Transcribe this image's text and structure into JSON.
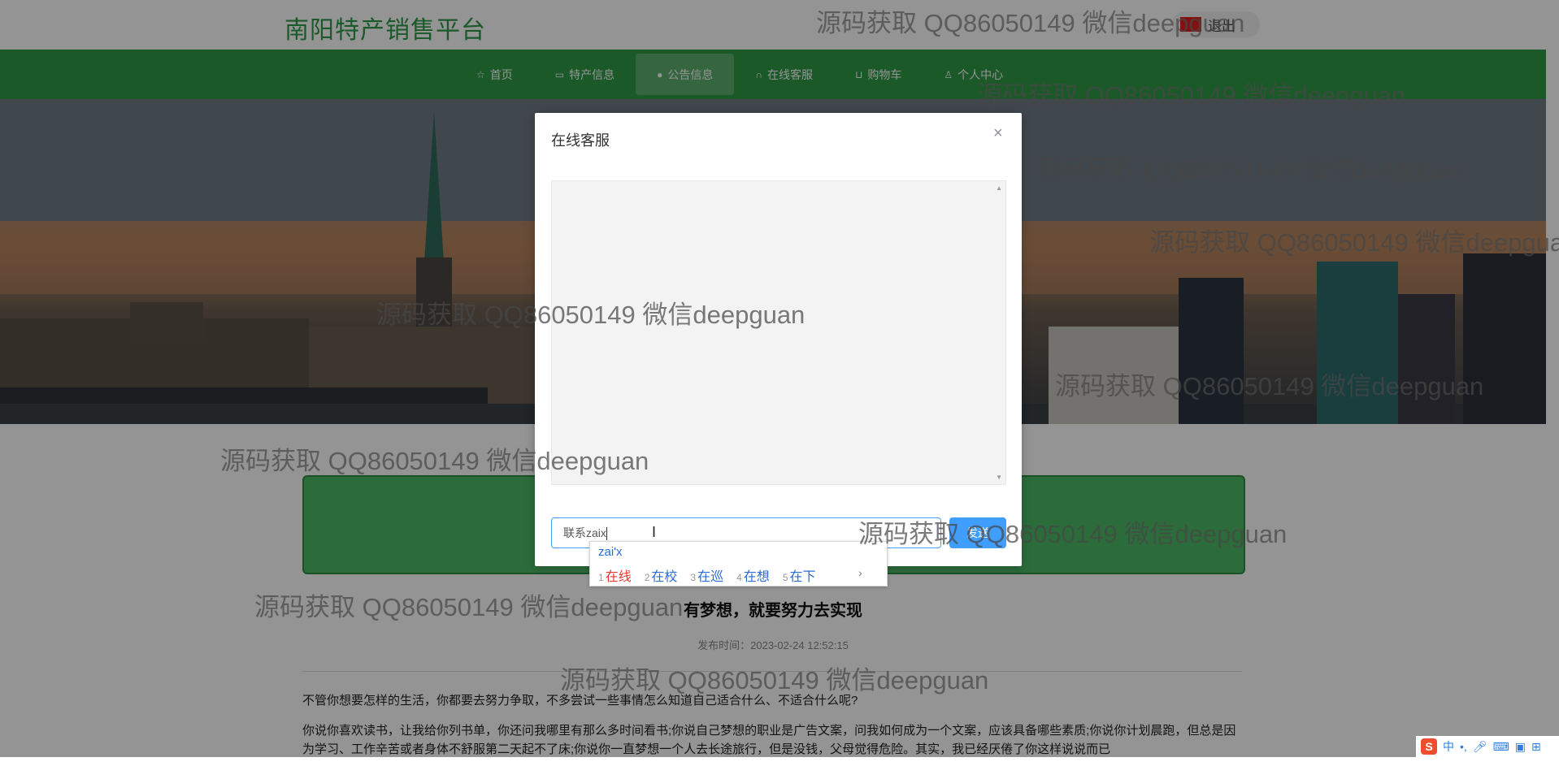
{
  "site": {
    "title": "南阳特产销售平台",
    "logout_label": "退出"
  },
  "nav": {
    "items": [
      {
        "label": "首页",
        "icon": "star-icon"
      },
      {
        "label": "特产信息",
        "icon": "bag-icon"
      },
      {
        "label": "公告信息",
        "icon": "info-icon"
      },
      {
        "label": "在线客服",
        "icon": "headset-icon"
      },
      {
        "label": "购物车",
        "icon": "cart-icon"
      },
      {
        "label": "个人中心",
        "icon": "user-icon"
      }
    ],
    "active": "公告信息"
  },
  "article": {
    "title": "有梦想，就要努力去实现",
    "time": "发布时间：2023-02-24 12:52:15",
    "para1": "不管你想要怎样的生活，你都要去努力争取，不多尝试一些事情怎么知道自己适合什么、不适合什么呢?",
    "para2": "你说你喜欢读书，让我给你列书单，你还问我哪里有那么多时间看书;你说自己梦想的职业是广告文案，问我如何成为一个文案，应该具备哪些素质;你说你计划晨跑，但总是因为学习、工作辛苦或者身体不舒服第二天起不了床;你说你一直梦想一个人去长途旅行，但是没钱，父母觉得危险。其实，我已经厌倦了你这样说说而已"
  },
  "modal": {
    "title": "在线客服",
    "close": "×",
    "input_value": "联系zaix",
    "send_label": "发送"
  },
  "ime": {
    "pinyin": "zai'x",
    "candidates": [
      {
        "num": "1",
        "text": "在线"
      },
      {
        "num": "2",
        "text": "在校"
      },
      {
        "num": "3",
        "text": "在巡"
      },
      {
        "num": "4",
        "text": "在想"
      },
      {
        "num": "5",
        "text": "在下"
      }
    ],
    "more": "›"
  },
  "status_bar": {
    "mode": "中",
    "punct": "•,"
  },
  "watermark": "源码获取 QQ86050149 微信deepguan",
  "colors": {
    "brand_green": "#2f9a47",
    "primary_blue": "#409eff",
    "candidate_first": "#e23b2e"
  }
}
